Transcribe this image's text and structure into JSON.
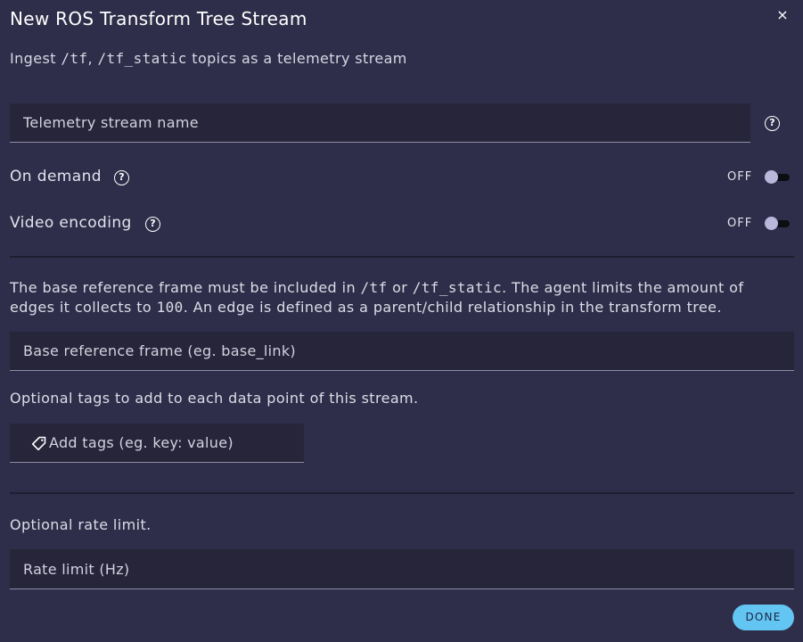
{
  "dialog": {
    "title": "New ROS Transform Tree Stream",
    "close_icon": "×",
    "subtitle": {
      "pre": "Ingest ",
      "topic_tf": "/tf",
      "sep": ", ",
      "topic_tf_static": "/tf_static",
      "post": " topics as a telemetry stream"
    }
  },
  "stream_name": {
    "placeholder": "Telemetry stream name",
    "value": "",
    "help_icon": "?"
  },
  "on_demand": {
    "label": "On demand",
    "help_icon": "?",
    "state_label": "OFF",
    "enabled": false
  },
  "video_encoding": {
    "label": "Video encoding",
    "help_icon": "?",
    "state_label": "OFF",
    "enabled": false
  },
  "base_frame_info": {
    "pre": "The base reference frame must be included in ",
    "topic_tf": "/tf",
    "or": " or ",
    "topic_tf_static": "/tf_static",
    "mid": ". The agent limits the amount of",
    "line2_pre": "edges it collects to ",
    "edge_limit": "100",
    "line2_post": ". An edge is defined as a parent/child relationship in the transform tree."
  },
  "base_frame": {
    "placeholder": "Base reference frame (eg. base_link)",
    "value": ""
  },
  "tags_info": "Optional tags to add to each data point of this stream.",
  "tags": {
    "placeholder": "Add tags (eg. key: value)",
    "icon": "tag-icon"
  },
  "rate_info": "Optional rate limit.",
  "rate_limit": {
    "placeholder": "Rate limit (Hz)",
    "value": ""
  },
  "done_label": "DONE",
  "colors": {
    "background": "#2f2e4a",
    "field": "#262539",
    "accent": "#63c5f2"
  }
}
